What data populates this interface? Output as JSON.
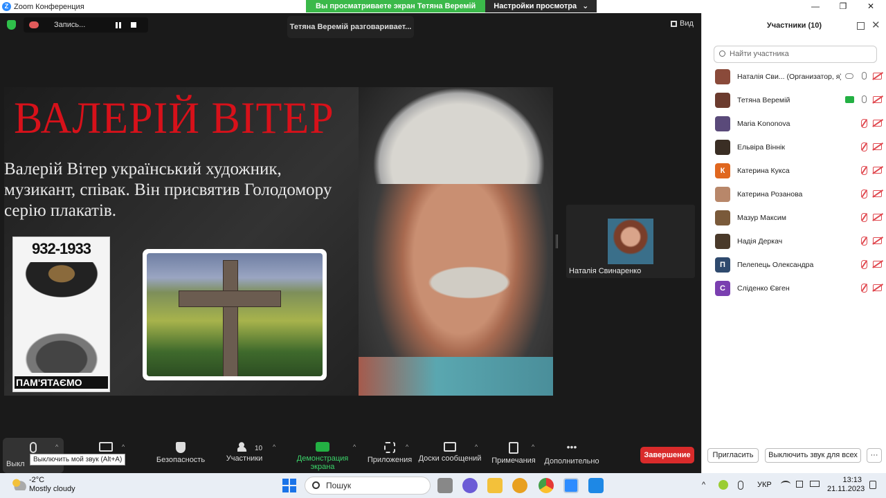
{
  "window": {
    "title": "Zoom Конференция",
    "app_icon_letter": "Z",
    "share_banner": "Вы просматриваете экран Тетяна Веремій",
    "view_settings": "Настройки просмотра",
    "chevron": "⌄",
    "minimize": "—",
    "maximize": "❐",
    "close": "✕"
  },
  "meeting": {
    "recording_label": "Запись...",
    "talking_label": "Тетяна Веремій разговаривает...",
    "view_label": "Вид"
  },
  "slide": {
    "title": "ВАЛЕРІЙ ВІТЕР",
    "text": "Валерій Вітер український художник, музикант, співак. Він присвятив Голодомору серію плакатів.",
    "poster_years": "932-1933",
    "poster_caption": "ПАМ'ЯТАЄМО"
  },
  "video_thumbnail": {
    "name": "Наталія Свинаренко"
  },
  "toolbar": {
    "mic_label": "Выкл",
    "tooltip": "Выключить мой звук (Alt+A)",
    "security": "Безопасность",
    "participants": "Участники",
    "participants_count": "10",
    "share": "Демонстрация экрана",
    "apps": "Приложения",
    "whiteboards": "Доски сообщений",
    "notes": "Примечания",
    "more": "Дополнительно",
    "end": "Завершение",
    "caret": "^"
  },
  "panel": {
    "title": "Участники (10)",
    "close": "✕",
    "search_placeholder": "Найти участника",
    "invite": "Пригласить",
    "mute_all": "Выключить звук для всех",
    "more": "···",
    "participants": [
      {
        "name": "Наталія Сви... (Организатор, я)",
        "initial": "",
        "color": "#8a4a3a",
        "status": "host"
      },
      {
        "name": "Тетяна Веремій",
        "initial": "",
        "color": "#6b3b2e",
        "status": "sharing"
      },
      {
        "name": "Maria Kononova",
        "initial": "",
        "color": "#5a4a7a",
        "status": "muted"
      },
      {
        "name": "Ельвіра Віннік",
        "initial": "",
        "color": "#3a2e24",
        "status": "muted"
      },
      {
        "name": "Катерина Кукса",
        "initial": "К",
        "color": "#e0671f",
        "status": "muted"
      },
      {
        "name": "Катерина Розанова",
        "initial": "",
        "color": "#b8876a",
        "status": "muted"
      },
      {
        "name": "Мазур Максим",
        "initial": "",
        "color": "#7a5a3a",
        "status": "muted"
      },
      {
        "name": "Надія Деркач",
        "initial": "",
        "color": "#4a3a2a",
        "status": "muted"
      },
      {
        "name": "Пелепець Олександра",
        "initial": "П",
        "color": "#2f4a6e",
        "status": "muted"
      },
      {
        "name": "Сліденко Євген",
        "initial": "С",
        "color": "#7a3fb0",
        "status": "muted"
      }
    ]
  },
  "taskbar": {
    "temperature": "-2°C",
    "weather": "Mostly cloudy",
    "search": "Пошук",
    "language": "УКР",
    "time": "13:13",
    "date": "21.11.2023",
    "tray_chevron": "^"
  }
}
